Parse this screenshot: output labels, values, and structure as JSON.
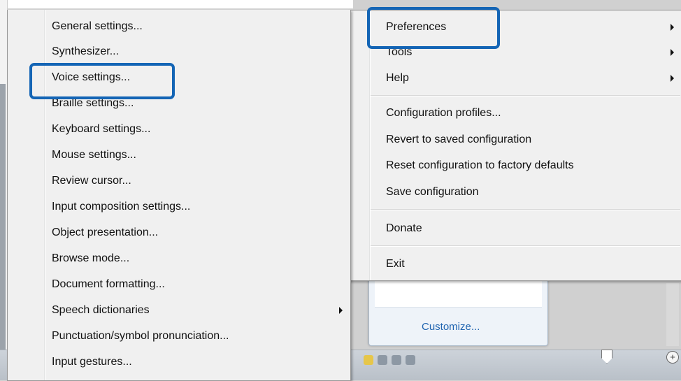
{
  "left_menu": {
    "items": [
      {
        "label": "General settings..."
      },
      {
        "label": "Synthesizer..."
      },
      {
        "label": "Voice settings..."
      },
      {
        "label": "Braille settings..."
      },
      {
        "label": "Keyboard settings..."
      },
      {
        "label": "Mouse settings..."
      },
      {
        "label": "Review cursor..."
      },
      {
        "label": "Input composition settings..."
      },
      {
        "label": "Object presentation..."
      },
      {
        "label": "Browse mode..."
      },
      {
        "label": "Document formatting..."
      },
      {
        "label": "Speech dictionaries"
      },
      {
        "label": "Punctuation/symbol pronunciation..."
      },
      {
        "label": "Input gestures..."
      }
    ]
  },
  "right_menu": {
    "items": [
      {
        "label": "Preferences"
      },
      {
        "label": "Tools"
      },
      {
        "label": "Help"
      },
      {
        "label": "Configuration profiles..."
      },
      {
        "label": "Revert to saved configuration"
      },
      {
        "label": "Reset configuration to factory defaults"
      },
      {
        "label": "Save configuration"
      },
      {
        "label": "Donate"
      },
      {
        "label": "Exit"
      }
    ]
  },
  "customize_popup": {
    "link_label": "Customize..."
  },
  "colors": {
    "highlight_border": "#1465b5",
    "menu_background": "#f0f0f0",
    "link": "#1f64b0"
  },
  "icons": [
    "submenu-arrow-icon",
    "zoom-in-icon"
  ]
}
